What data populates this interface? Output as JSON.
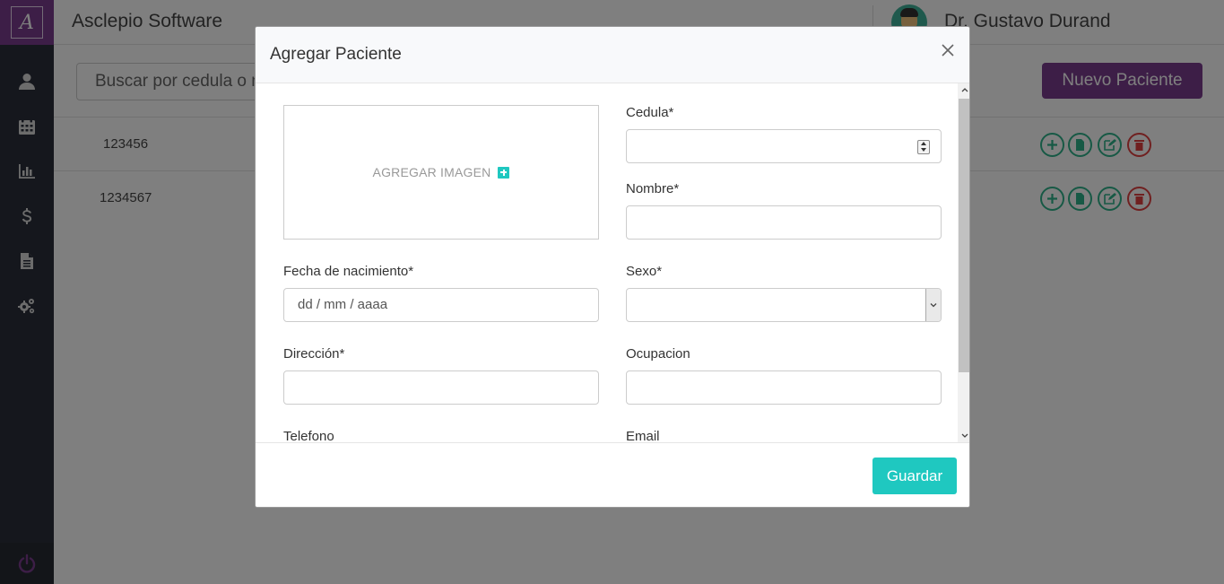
{
  "app": {
    "title": "Asclepio Software",
    "logo_letter": "A"
  },
  "user": {
    "name": "Dr. Gustavo Durand"
  },
  "sidebar": {
    "items": [
      {
        "icon": "user-icon"
      },
      {
        "icon": "calendar-icon"
      },
      {
        "icon": "bar-chart-icon"
      },
      {
        "icon": "dollar-icon"
      },
      {
        "icon": "document-icon"
      },
      {
        "icon": "gears-icon"
      }
    ],
    "logout_icon": "power-icon"
  },
  "toolbar": {
    "search_placeholder": "Buscar por cedula o nombre",
    "new_patient_label": "Nuevo Paciente"
  },
  "table": {
    "rows": [
      {
        "cedula": "123456"
      },
      {
        "cedula": "1234567"
      }
    ],
    "actions": [
      "add-icon",
      "file-icon",
      "edit-icon",
      "trash-icon"
    ]
  },
  "modal": {
    "title": "Agregar Paciente",
    "image_label": "AGREGAR IMAGEN",
    "fields": {
      "cedula": "Cedula*",
      "nombre": "Nombre*",
      "fecha": "Fecha de nacimiento*",
      "fecha_placeholder": "dd / mm / aaaa",
      "sexo": "Sexo*",
      "direccion": "Dirección*",
      "ocupacion": "Ocupacion",
      "telefono": "Telefono",
      "email": "Email"
    },
    "save_label": "Guardar"
  },
  "colors": {
    "brand": "#7a3d8f",
    "accent": "#1fc8c0",
    "sidebar": "#2b2f3a",
    "action_green": "#2fb38a",
    "action_red": "#e04040"
  }
}
